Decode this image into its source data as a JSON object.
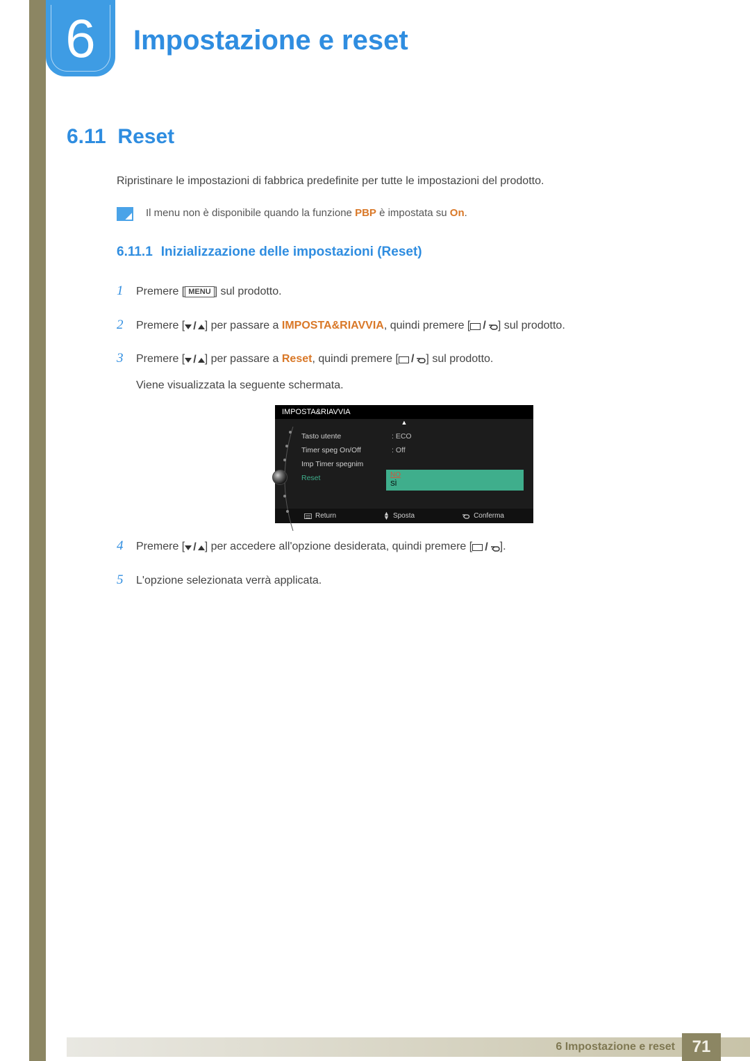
{
  "chapter": {
    "number": "6",
    "title": "Impostazione e reset"
  },
  "section": {
    "number": "6.11",
    "title": "Reset",
    "intro": "Ripristinare le impostazioni di fabbrica predefinite per tutte le impostazioni del prodotto."
  },
  "note": {
    "pre": "Il menu non è disponibile quando la funzione ",
    "hl1": "PBP",
    "mid": " è impostata su ",
    "hl2": "On",
    "post": "."
  },
  "subsection": {
    "number": "6.11.1",
    "title": "Inizializzazione delle impostazioni (Reset)"
  },
  "keys": {
    "menu": "MENU"
  },
  "steps": {
    "s1": {
      "num": "1",
      "pre": "Premere [",
      "post": "] sul prodotto."
    },
    "s2": {
      "num": "2",
      "pre": "Premere [",
      "mid1": "] per passare a ",
      "hl": "IMPOSTA&RIAVVIA",
      "mid2": ", quindi premere [",
      "post": "] sul prodotto."
    },
    "s3": {
      "num": "3",
      "pre": "Premere [",
      "mid1": "] per passare a ",
      "hl": "Reset",
      "mid2": ", quindi premere [",
      "post": "] sul prodotto.",
      "sub": "Viene visualizzata la seguente schermata."
    },
    "s4": {
      "num": "4",
      "pre": "Premere [",
      "mid": "] per accedere all'opzione desiderata, quindi premere [",
      "post": "]."
    },
    "s5": {
      "num": "5",
      "text": "L'opzione selezionata verrà applicata."
    }
  },
  "osd": {
    "title": "IMPOSTA&RIAVVIA",
    "menu_items": [
      "Tasto utente",
      "Timer speg On/Off",
      "Imp Timer spegnim",
      "Reset"
    ],
    "values": [
      "ECO",
      "Off"
    ],
    "popup": {
      "opt1": "NO",
      "opt2": "SÌ"
    },
    "footer": {
      "return": "Return",
      "move": "Sposta",
      "confirm": "Conferma"
    }
  },
  "footer": {
    "label_num": "6",
    "label_text": "Impostazione e reset",
    "page": "71"
  }
}
